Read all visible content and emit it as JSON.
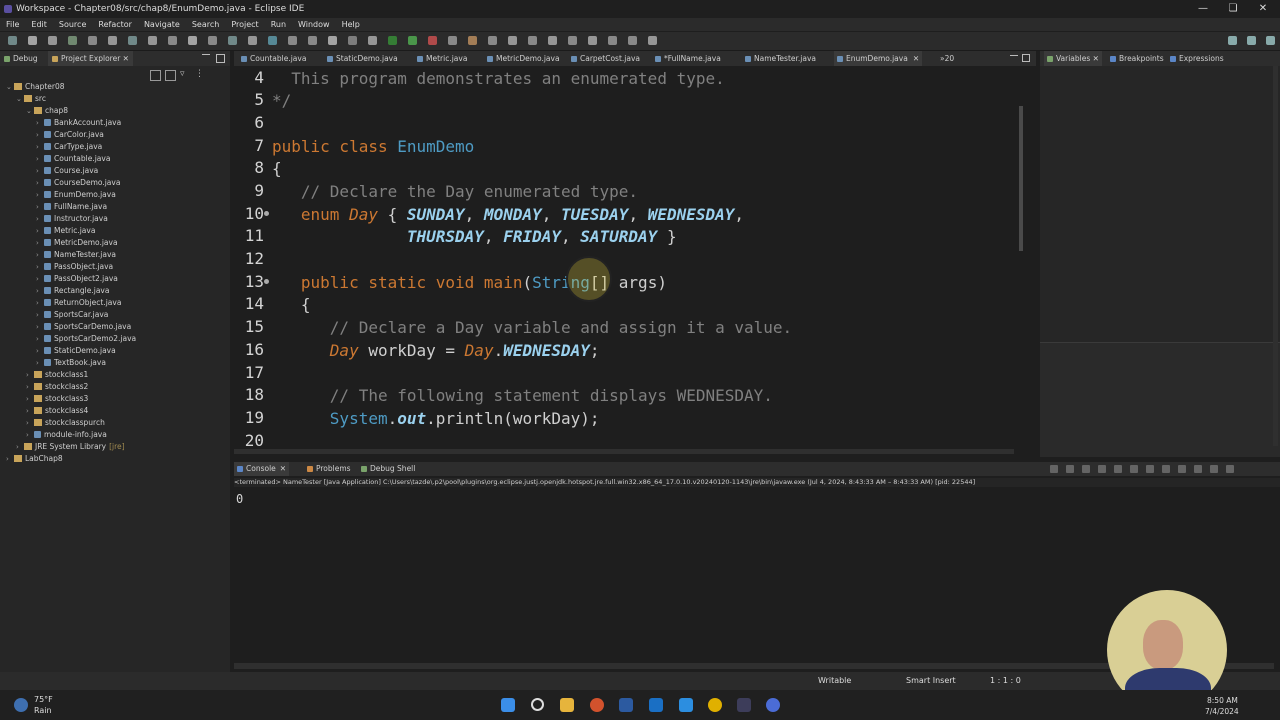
{
  "window": {
    "title": "Workspace - Chapter08/src/chap8/EnumDemo.java - Eclipse IDE"
  },
  "menu": [
    "File",
    "Edit",
    "Source",
    "Refactor",
    "Navigate",
    "Search",
    "Project",
    "Run",
    "Window",
    "Help"
  ],
  "left_tabs": {
    "debug": "Debug",
    "explorer": "Project Explorer"
  },
  "tree": {
    "project": "Chapter08",
    "src": "src",
    "package": "chap8",
    "files": [
      "BankAccount.java",
      "CarColor.java",
      "CarType.java",
      "Countable.java",
      "Course.java",
      "CourseDemo.java",
      "EnumDemo.java",
      "FullName.java",
      "Instructor.java",
      "Metric.java",
      "MetricDemo.java",
      "NameTester.java",
      "PassObject.java",
      "PassObject2.java",
      "Rectangle.java",
      "ReturnObject.java",
      "SportsCar.java",
      "SportsCarDemo.java",
      "SportsCarDemo2.java",
      "StaticDemo.java",
      "TextBook.java"
    ],
    "packages": [
      "stockclass1",
      "stockclass2",
      "stockclass3",
      "stockclass4",
      "stockclasspurch"
    ],
    "module": "module-info.java",
    "jre": "JRE System Library",
    "jre_suffix": "[jre]",
    "lab": "LabChap8"
  },
  "editor_tabs": [
    "Countable.java",
    "StaticDemo.java",
    "Metric.java",
    "MetricDemo.java",
    "CarpetCost.java",
    "*FullName.java",
    "NameTester.java",
    "EnumDemo.java"
  ],
  "editor_overflow": "»20",
  "code": {
    "line_numbers": [
      "4",
      "5",
      "6",
      "7",
      "8",
      "9",
      "10",
      "11",
      "12",
      "13",
      "14",
      "15",
      "16",
      "17",
      "18",
      "19",
      "20"
    ],
    "l4": "  This program demonstrates an enumerated type.",
    "l5": "*/",
    "l7a": "public class ",
    "l7b": "EnumDemo",
    "l8": "{",
    "l9": "   // Declare the Day enumerated type.",
    "l10a": "   enum ",
    "l10b": "Day",
    "l10c": " { ",
    "l10d": "SUNDAY",
    "l10e": ", ",
    "l10f": "MONDAY",
    "l10g": ", ",
    "l10h": "TUESDAY",
    "l10i": ", ",
    "l10j": "WEDNESDAY",
    "l10k": ",",
    "l11a": "              ",
    "l11b": "THURSDAY",
    "l11c": ", ",
    "l11d": "FRIDAY",
    "l11e": ", ",
    "l11f": "SATURDAY",
    "l11g": " }",
    "l13a": "   public static void ",
    "l13b": "main",
    "l13c": "(",
    "l13d": "String",
    "l13e": "[] args)",
    "l14": "   {",
    "l15": "      // Declare a Day variable and assign it a value.",
    "l16a": "      ",
    "l16b": "Day",
    "l16c": " workDay = ",
    "l16d": "Day",
    "l16e": ".",
    "l16f": "WEDNESDAY",
    "l16g": ";",
    "l18": "      // The following statement displays WEDNESDAY.",
    "l19a": "      ",
    "l19b": "System",
    "l19c": ".",
    "l19d": "out",
    "l19e": ".println(workDay);"
  },
  "right_tabs": {
    "variables": "Variables",
    "breakpoints": "Breakpoints",
    "expressions": "Expressions"
  },
  "console": {
    "tabs": [
      "Console",
      "Problems",
      "Debug Shell"
    ],
    "header": "<terminated> NameTester [Java Application] C:\\Users\\tazde\\.p2\\pool\\plugins\\org.eclipse.justj.openjdk.hotspot.jre.full.win32.x86_64_17.0.10.v20240120-1143\\jre\\bin\\javaw.exe (Jul 4, 2024, 8:43:33 AM – 8:43:33 AM) [pid: 22544]",
    "output": "0"
  },
  "status": {
    "writable": "Writable",
    "insert": "Smart Insert",
    "position": "1 : 1 : 0"
  },
  "taskbar": {
    "weather_temp": "75°F",
    "weather_desc": "Rain",
    "time": "8:50 AM",
    "date": "7/4/2024"
  },
  "colors": {
    "accent": "#4c8ed6",
    "keyword": "#cc7832",
    "comment": "#808080",
    "enum_const": "#9bd1ee",
    "class": "#4e9bc4"
  }
}
